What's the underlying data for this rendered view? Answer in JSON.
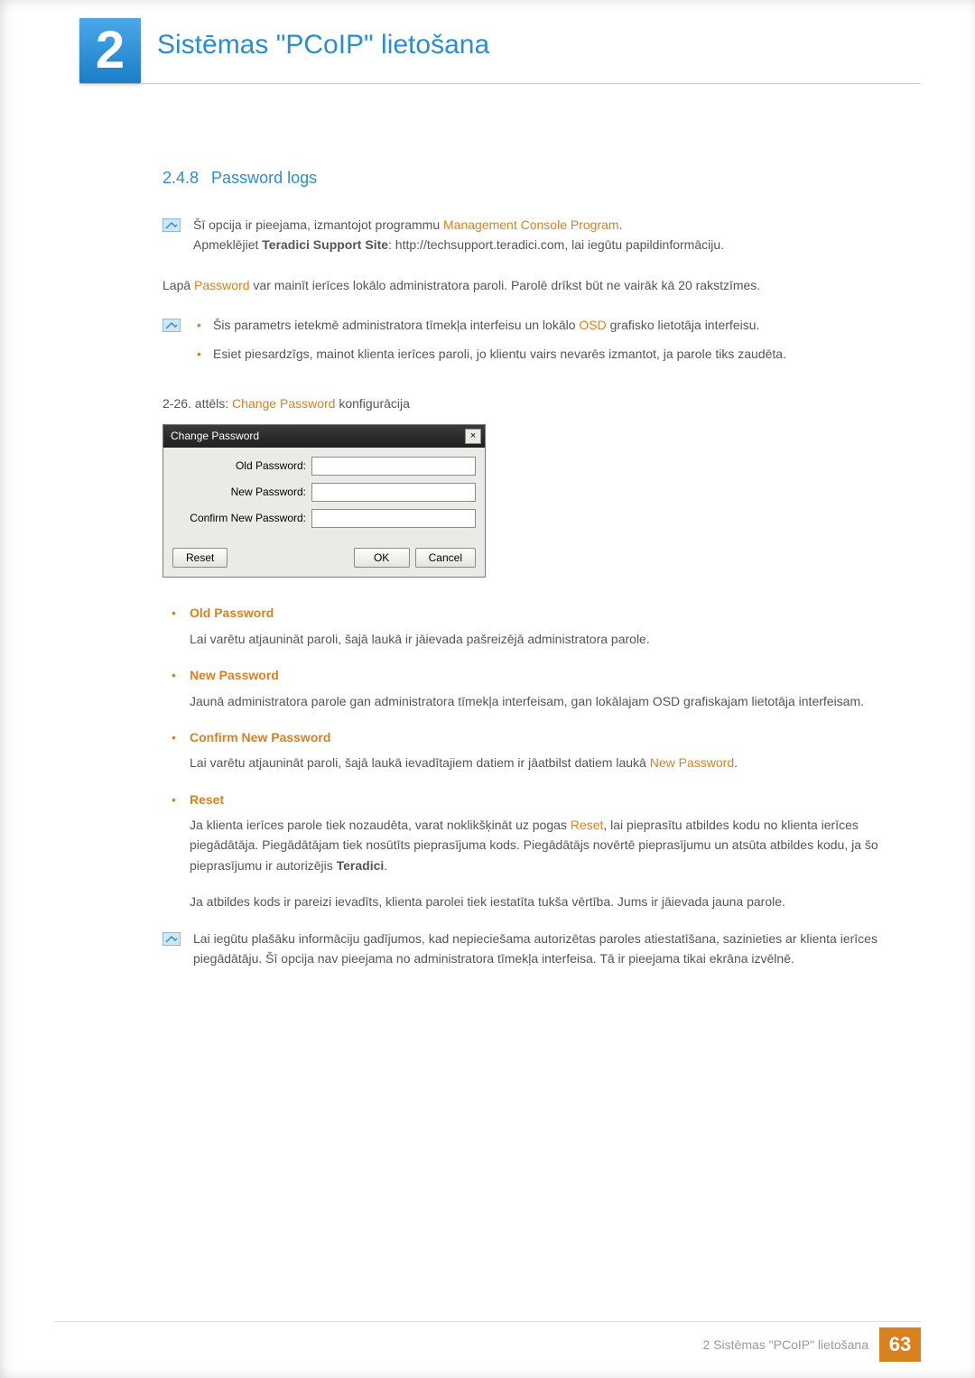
{
  "header": {
    "chapter_number": "2",
    "chapter_title": "Sistēmas \"PCoIP\" lietošana"
  },
  "section": {
    "number": "2.4.8",
    "title": "Password logs"
  },
  "note1": {
    "line1_a": "Šī opcija ir pieejama, izmantojot programmu ",
    "line1_hl": "Management Console Program",
    "line1_b": ".",
    "line2_a": "Apmeklējiet ",
    "line2_bold": "Teradici Support Site",
    "line2_b": ": http://techsupport.teradici.com, lai iegūtu papildinformāciju."
  },
  "intro": {
    "a": "Lapā ",
    "hl": "Password",
    "b": " var mainīt ierīces lokālo administratora paroli. Parolē drīkst būt ne vairāk kā 20 rakstzīmes."
  },
  "note2": {
    "bullet1_a": "Šis parametrs ietekmē administratora tīmekļa interfeisu un lokālo ",
    "bullet1_hl": "OSD",
    "bullet1_b": " grafisko lietotāja interfeisu.",
    "bullet2": "Esiet piesardzīgs, mainot klienta ierīces paroli, jo klientu vairs nevarēs izmantot, ja parole tiks zaudēta."
  },
  "figure": {
    "a": "2-26. attēls: ",
    "hl": "Change Password",
    "b": " konfigurācija"
  },
  "dialog": {
    "title": "Change Password",
    "old_label": "Old Password:",
    "new_label": "New Password:",
    "confirm_label": "Confirm New Password:",
    "reset": "Reset",
    "ok": "OK",
    "cancel": "Cancel"
  },
  "params": {
    "old": {
      "title": "Old Password",
      "desc": "Lai varētu atjaunināt paroli, šajā laukā ir jāievada pašreizējā administratora parole."
    },
    "new": {
      "title": "New Password",
      "desc": "Jaunā administratora parole gan administratora tīmekļa interfeisam, gan lokālajam OSD grafiskajam lietotāja interfeisam."
    },
    "confirm": {
      "title": "Confirm New Password",
      "desc_a": "Lai varētu atjaunināt paroli, šajā laukā ievadītajiem datiem ir jāatbilst datiem laukā ",
      "desc_hl": "New Password",
      "desc_b": "."
    },
    "reset": {
      "title": "Reset",
      "desc1_a": "Ja klienta ierīces parole tiek nozaudēta, varat noklikšķināt uz pogas ",
      "desc1_hl": "Reset",
      "desc1_b": ", lai pieprasītu atbildes kodu no klienta ierīces piegādātāja. Piegādātājam tiek nosūtīts pieprasījuma kods. Piegādātājs novērtē pieprasījumu un atsūta atbildes kodu, ja šo pieprasījumu ir autorizējis ",
      "desc1_bold": "Teradici",
      "desc1_c": ".",
      "desc2": "Ja atbildes kods ir pareizi ievadīts, klienta parolei tiek iestatīta tukša vērtība. Jums ir jāievada jauna parole."
    }
  },
  "note3": {
    "text": "Lai iegūtu plašāku informāciju gadījumos, kad nepieciešama autorizētas paroles atiestatīšana, sazinieties ar klienta ierīces piegādātāju. Šī opcija nav pieejama no administratora tīmekļa interfeisa. Tā ir pieejama tikai ekrāna izvēlnē."
  },
  "footer": {
    "text": "2 Sistēmas \"PCoIP\" lietošana",
    "page": "63"
  }
}
